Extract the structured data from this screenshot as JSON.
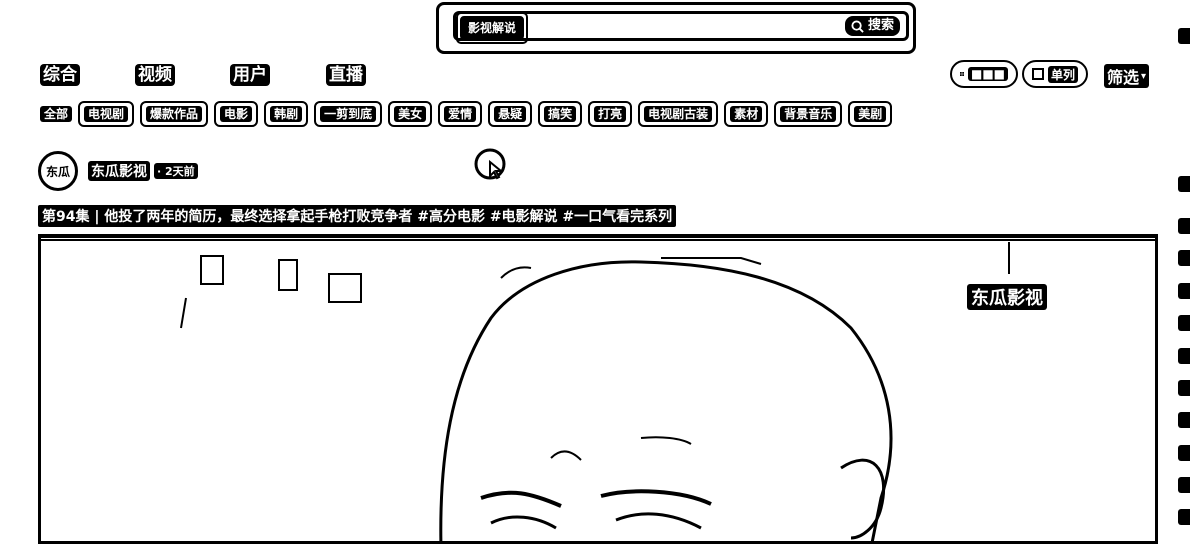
{
  "search": {
    "tag": "影视解说",
    "value": "",
    "placeholder": "",
    "button_label": "搜索"
  },
  "nav": {
    "tabs": [
      "综合",
      "视频",
      "用户",
      "直播"
    ],
    "tiles_label": "■■■",
    "single_label": "单列",
    "filter_label": "筛选"
  },
  "chips": [
    "全部",
    "电视剧",
    "爆款作品",
    "电影",
    "韩剧",
    "一剪到底",
    "美女",
    "爱情",
    "悬疑",
    "搞笑",
    "打亮",
    "电视剧古装",
    "素材",
    "背景音乐",
    "美剧"
  ],
  "post": {
    "avatar_text": "东瓜",
    "author": "东瓜影视",
    "time": "· 2天前",
    "title": "第94集 | 他投了两年的简历，最终选择拿起手枪打败竞争者 #高分电影 #电影解说 #一口气看完系列",
    "watermark": "东瓜影视"
  }
}
